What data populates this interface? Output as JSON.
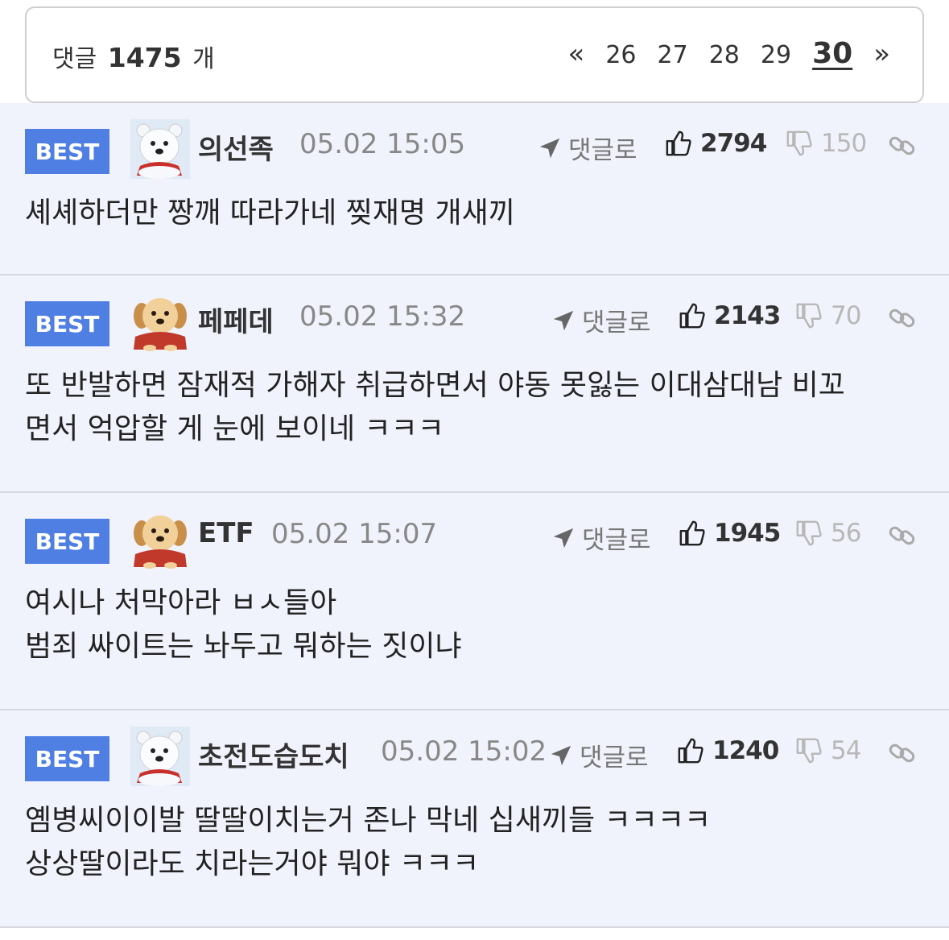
{
  "header": {
    "count_prefix": "댓글",
    "count": "1475",
    "count_suffix": "개",
    "pages": [
      "26",
      "27",
      "28",
      "29",
      "30"
    ],
    "current_page": "30",
    "prev": "«",
    "next": "»"
  },
  "comments": [
    {
      "badge": "BEST",
      "avatar": "polar-bear-icon",
      "user": "의선족",
      "time": "05.02 15:05",
      "reply_label": "댓글로",
      "likes": "2794",
      "dislikes": "150",
      "lines": [
        "셰셰하더만 짱깨 따라가네 찢재명 개새끼"
      ]
    },
    {
      "badge": "BEST",
      "avatar": "puppy-icon",
      "user": "페페데",
      "time": "05.02 15:32",
      "reply_label": "댓글로",
      "likes": "2143",
      "dislikes": "70",
      "lines": [
        "또 반발하면 잠재적 가해자 취급하면서 야동 못잃는 이대삼대남 비꼬",
        "면서 억압할 게 눈에 보이네 ㅋㅋㅋ"
      ]
    },
    {
      "badge": "BEST",
      "avatar": "puppy-icon",
      "user": "ETF",
      "time": "05.02 15:07",
      "reply_label": "댓글로",
      "likes": "1945",
      "dislikes": "56",
      "lines": [
        "여시나 처막아라 ㅂㅅ들아",
        "범죄 싸이트는 놔두고 뭐하는 짓이냐"
      ]
    },
    {
      "badge": "BEST",
      "avatar": "polar-bear-icon",
      "user": "초전도습도치",
      "time": "05.02 15:02",
      "reply_label": "댓글로",
      "likes": "1240",
      "dislikes": "54",
      "lines": [
        "옘병씨이이발 딸딸이치는거 존나 막네 십새끼들 ㅋㅋㅋㅋ",
        "상상딸이라도 치라는거야 뭐야 ㅋㅋㅋ"
      ]
    }
  ]
}
